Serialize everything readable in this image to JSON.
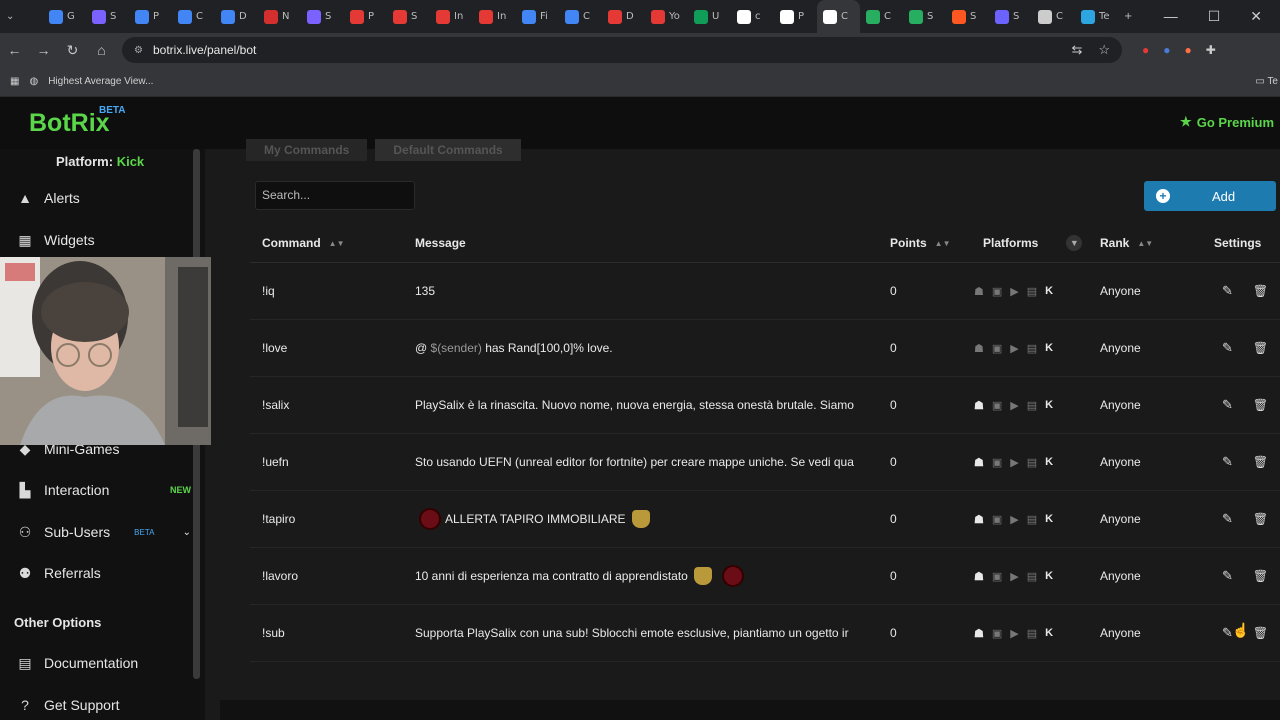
{
  "browser": {
    "tabs": [
      "G",
      "S",
      "P",
      "C",
      "D",
      "N",
      "S",
      "P",
      "S",
      "In",
      "In",
      "Fi",
      "C",
      "D",
      "Yo",
      "U",
      "c",
      "P",
      "C",
      "C",
      "S",
      "S",
      "S",
      "C",
      "Te"
    ],
    "active_tab": "C",
    "url": "botrix.live/panel/bot",
    "bookmark": "Highest Average View..."
  },
  "header": {
    "logo": "BotRix",
    "logo_badge": "BETA",
    "premium": "Go Premium"
  },
  "sidebar": {
    "platform_label": "Platform:",
    "platform_value": "Kick",
    "items": [
      {
        "label": "Alerts"
      },
      {
        "label": "Widgets"
      },
      {
        "label": "Mini-Games"
      },
      {
        "label": "Interaction",
        "badge": "NEW"
      },
      {
        "label": "Sub-Users",
        "badge": "BETA"
      },
      {
        "label": "Referrals"
      }
    ],
    "section_other": "Other Options",
    "other_items": [
      {
        "label": "Documentation"
      },
      {
        "label": "Get Support"
      }
    ]
  },
  "main": {
    "tabs": [
      "My Commands",
      "Default Commands"
    ],
    "search_placeholder": "Search...",
    "add_label": "Add",
    "columns": [
      "Command",
      "Message",
      "Points",
      "Platforms",
      "Rank",
      "Settings"
    ],
    "rows": [
      {
        "command": "!iq",
        "message": "135",
        "points": "0",
        "rank": "Anyone"
      },
      {
        "command": "!love",
        "message_pre": "@ ",
        "message_var": "$(sender)",
        "message_post": " has Rand[100,0]% love.",
        "points": "0",
        "rank": "Anyone"
      },
      {
        "command": "!salix",
        "message": "PlaySalix è la rinascita. Nuovo nome, nuova energia, stessa onestà brutale. Siamo",
        "points": "0",
        "rank": "Anyone"
      },
      {
        "command": "!uefn",
        "message": "Sto usando UEFN (unreal editor for fortnite) per creare mappe uniche. Se vedi qua",
        "points": "0",
        "rank": "Anyone"
      },
      {
        "command": "!tapiro",
        "message": "ALLERTA TAPIRO IMMOBILIARE",
        "points": "0",
        "rank": "Anyone"
      },
      {
        "command": "!lavoro",
        "message": "10 anni di esperienza ma contratto di apprendistato",
        "points": "0",
        "rank": "Anyone"
      },
      {
        "command": "!sub",
        "message": "Supporta PlaySalix con una sub! Sblocchi emote esclusive, piantiamo un ogetto ir",
        "points": "0",
        "rank": "Anyone"
      }
    ]
  },
  "colors": {
    "brand": "#5bd64b",
    "accent": "#1e7bb0",
    "beta": "#49a8f5"
  },
  "icons": [
    "chevron-down-icon",
    "back-icon",
    "forward-icon",
    "reload-icon",
    "home-icon",
    "star-icon",
    "warning-icon",
    "widgets-icon",
    "interaction-icon",
    "users-icon",
    "referrals-icon",
    "document-icon",
    "help-icon",
    "plus-icon",
    "filter-icon",
    "edit-icon",
    "trash-icon",
    "kick-icon"
  ]
}
